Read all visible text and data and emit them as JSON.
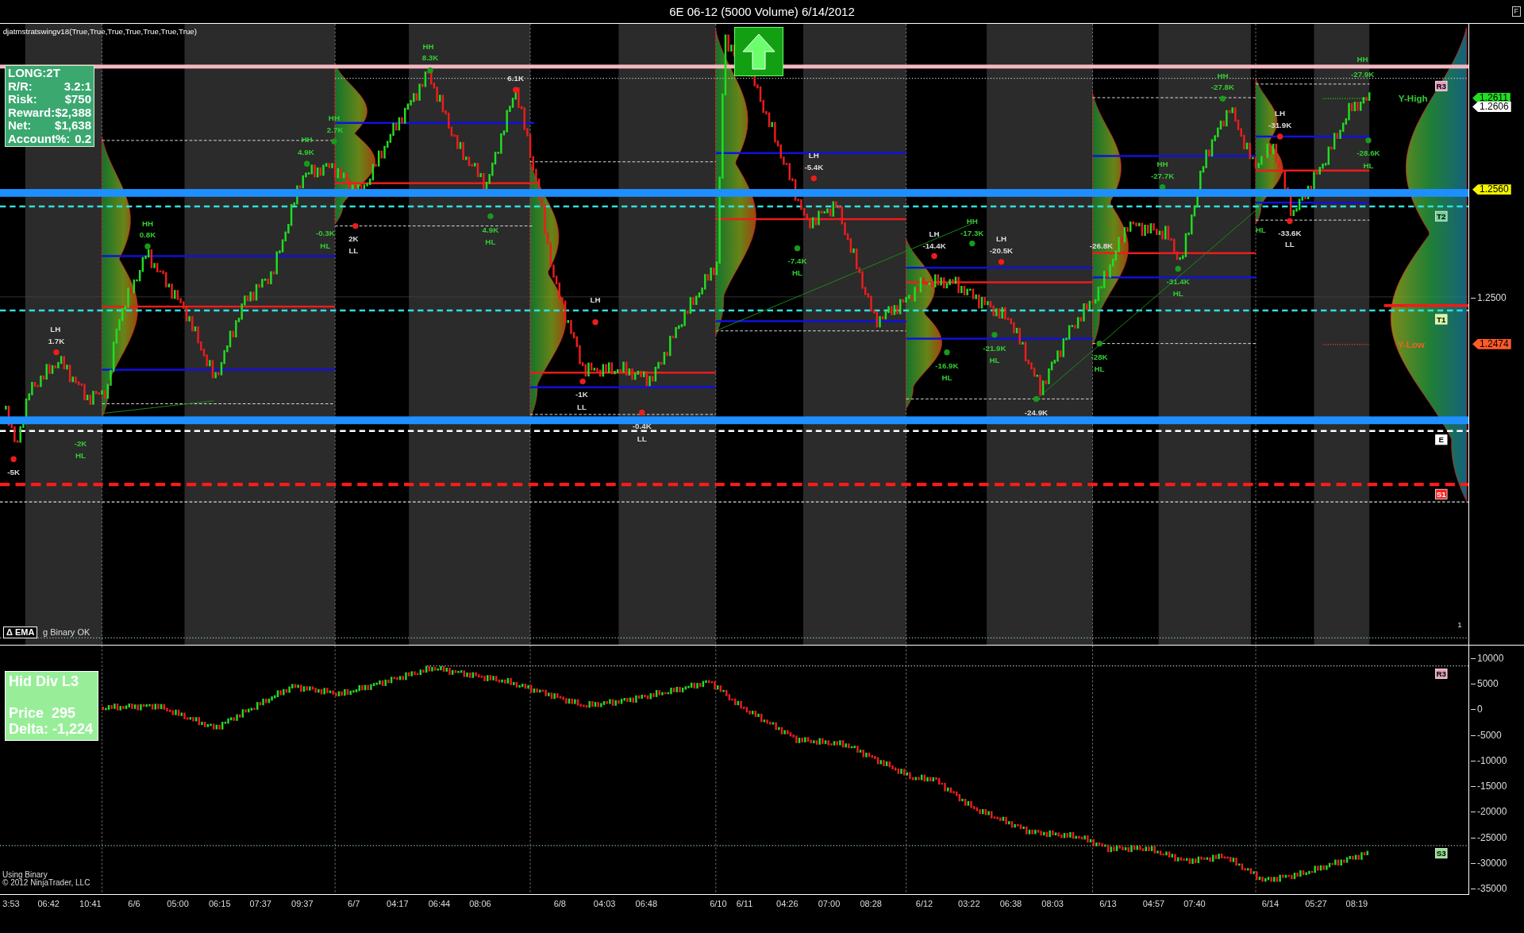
{
  "window": {
    "title": "6E 06-12 (5000 Volume)  6/14/2012",
    "corner_label": "F"
  },
  "price_panel": {
    "indicator_label": "djatmstratswingv18(True,True,True,True,True,True,True)",
    "position_box": {
      "heading": "LONG:2T",
      "rows": [
        {
          "label": "R/R:",
          "value": "3.2:1"
        },
        {
          "label": "Risk:",
          "value": "$750"
        },
        {
          "label": "Reward:",
          "value": "$2,388"
        },
        {
          "label": "Net:",
          "value": "$1,638"
        },
        {
          "label": "Account%:",
          "value": "0.2"
        }
      ]
    },
    "swing_labels": [
      {
        "text": "HH",
        "color": "#33cc33"
      },
      {
        "text": "8.3K",
        "color": "#33cc33"
      },
      {
        "text": "6.1K",
        "color": "#dddddd"
      },
      {
        "text": "HH",
        "color": "#33cc33"
      },
      {
        "text": "2.7K",
        "color": "#33cc33"
      },
      {
        "text": "HH",
        "color": "#33cc33"
      },
      {
        "text": "4.9K",
        "color": "#33cc33"
      },
      {
        "text": "HH",
        "color": "#33cc33"
      },
      {
        "text": "0.8K",
        "color": "#33cc33"
      },
      {
        "text": "LH",
        "color": "#dddddd"
      },
      {
        "text": "1.7K",
        "color": "#dddddd"
      },
      {
        "text": "-5K",
        "color": "#dddddd"
      },
      {
        "text": "-2K",
        "color": "#33cc33"
      },
      {
        "text": "HL",
        "color": "#33cc33"
      },
      {
        "text": "-0.3K",
        "color": "#33cc33"
      },
      {
        "text": "HL",
        "color": "#33cc33"
      },
      {
        "text": "2K",
        "color": "#dddddd"
      },
      {
        "text": "LL",
        "color": "#dddddd"
      },
      {
        "text": "4.9K",
        "color": "#33cc33"
      },
      {
        "text": "HL",
        "color": "#33cc33"
      },
      {
        "text": "LH",
        "color": "#dddddd"
      },
      {
        "text": "-1K",
        "color": "#dddddd"
      },
      {
        "text": "LL",
        "color": "#dddddd"
      },
      {
        "text": "-0.4K",
        "color": "#dddddd"
      },
      {
        "text": "LL",
        "color": "#dddddd"
      },
      {
        "text": "LH",
        "color": "#dddddd"
      },
      {
        "text": "-5.4K",
        "color": "#dddddd"
      },
      {
        "text": "-7.4K",
        "color": "#33cc33"
      },
      {
        "text": "HL",
        "color": "#33cc33"
      },
      {
        "text": "LH",
        "color": "#dddddd"
      },
      {
        "text": "-14.4K",
        "color": "#dddddd"
      },
      {
        "text": "HH",
        "color": "#33cc33"
      },
      {
        "text": "-17.3K",
        "color": "#33cc33"
      },
      {
        "text": "LH",
        "color": "#dddddd"
      },
      {
        "text": "-20.5K",
        "color": "#dddddd"
      },
      {
        "text": "-16.9K",
        "color": "#33cc33"
      },
      {
        "text": "HL",
        "color": "#33cc33"
      },
      {
        "text": "-21.9K",
        "color": "#33cc33"
      },
      {
        "text": "HL",
        "color": "#33cc33"
      },
      {
        "text": "-24.9K",
        "color": "#dddddd"
      },
      {
        "text": "-26.8K",
        "color": "#dddddd"
      },
      {
        "text": "-28K",
        "color": "#33cc33"
      },
      {
        "text": "HL",
        "color": "#33cc33"
      },
      {
        "text": "HH",
        "color": "#33cc33"
      },
      {
        "text": "-27.7K",
        "color": "#33cc33"
      },
      {
        "text": "HH",
        "color": "#33cc33"
      },
      {
        "text": "-27.8K",
        "color": "#33cc33"
      },
      {
        "text": "-31.4K",
        "color": "#33cc33"
      },
      {
        "text": "HL",
        "color": "#33cc33"
      },
      {
        "text": "LH",
        "color": "#dddddd"
      },
      {
        "text": "-31.9K",
        "color": "#dddddd"
      },
      {
        "text": "-33.6K",
        "color": "#dddddd"
      },
      {
        "text": "LL",
        "color": "#dddddd"
      },
      {
        "text": "HL",
        "color": "#33cc33"
      },
      {
        "text": "HH",
        "color": "#33cc33"
      },
      {
        "text": "-27.9K",
        "color": "#33cc33"
      },
      {
        "text": "-28.6K",
        "color": "#33cc33"
      },
      {
        "text": "HL",
        "color": "#33cc33"
      }
    ],
    "level_labels": [
      {
        "text": "Y-High",
        "color": "#33cc33"
      },
      {
        "text": "Y-Low",
        "color": "#f0602a"
      }
    ],
    "level_markers": [
      {
        "text": "R3",
        "color": "#e8a0c0"
      },
      {
        "text": "T2",
        "color": "#6fcf97"
      },
      {
        "text": "T1",
        "color": "#d8f5a0"
      },
      {
        "text": "E",
        "color": "#ffffff"
      },
      {
        "text": "S1",
        "color": "#ff2020"
      }
    ],
    "price_axis": [
      {
        "kind": "tag",
        "text": "1.2611",
        "color": "#22dd22"
      },
      {
        "kind": "tag",
        "text": "1.2606",
        "color": "#ffffff"
      },
      {
        "kind": "tag",
        "text": "1.2560",
        "color": "#f5f500"
      },
      {
        "kind": "tick",
        "text": "1.2500"
      },
      {
        "kind": "tag",
        "text": "1.2474",
        "color": "#ff5a28"
      }
    ],
    "pane_number": "1",
    "ema_badge": "Δ EMA",
    "status_text": "g Binary OK"
  },
  "delta_panel": {
    "info_box": {
      "title": "Hid Div L3",
      "lines": [
        "Price  295",
        "Delta: -1,224"
      ]
    },
    "level_markers": [
      {
        "text": "R3",
        "color": "#e8a0c0"
      },
      {
        "text": "S3",
        "color": "#90e090"
      }
    ],
    "axis_ticks": [
      "10000",
      "5000",
      "0",
      "-5000",
      "-10000",
      "-15000",
      "-20000",
      "-25000",
      "-30000",
      "-35000"
    ],
    "footer": [
      "Using Binary",
      "© 2012 NinjaTrader, LLC"
    ]
  },
  "x_axis": {
    "labels": [
      "3:53",
      "06:42",
      "10:41",
      "6/6",
      "05:00",
      "06:15",
      "07:37",
      "09:37",
      "6/7",
      "04:17",
      "06:44",
      "08:06",
      "6/8",
      "04:03",
      "06:48",
      "6/10",
      "6/11",
      "04:26",
      "07:00",
      "08:28",
      "6/12",
      "03:22",
      "06:38",
      "08:03",
      "6/13",
      "04:57",
      "07:40",
      "6/14",
      "05:27",
      "08:19"
    ]
  }
}
